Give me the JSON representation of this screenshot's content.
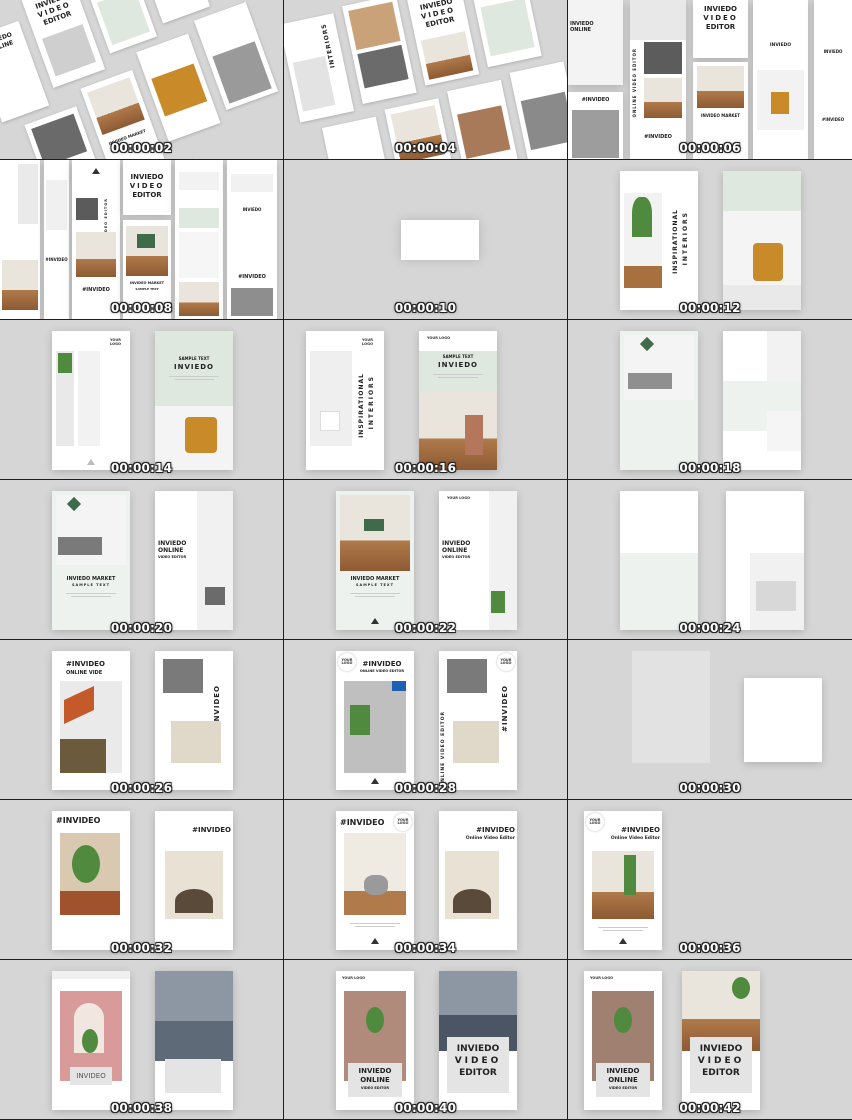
{
  "timestamps": [
    "00:00:02",
    "00:00:04",
    "00:00:06",
    "00:00:08",
    "00:00:10",
    "00:00:12",
    "00:00:14",
    "00:00:16",
    "00:00:18",
    "00:00:20",
    "00:00:22",
    "00:00:24",
    "00:00:26",
    "00:00:28",
    "00:00:30",
    "00:00:32",
    "00:00:34",
    "00:00:36",
    "00:00:38",
    "00:00:40",
    "00:00:42"
  ],
  "text": {
    "inviedo": "INVIEDO",
    "video": "VIDEO",
    "editor": "EDITOR",
    "online": "ONLINE",
    "inviedo_online": "INVIEDO ONLINE",
    "inviedo_video_editor": "INVIEDO VIDEO EDITOR",
    "inviedo_market": "INVIEDO MARKET",
    "invideo_market": "INVIDEO MARKET",
    "sample_text": "SAMPLE TEXT",
    "sample_text_small": "SAMPLE TEXT",
    "invideo": "INVIDEO",
    "invideo_upper": "INVIDEO",
    "invideo_caps": "INVIDEO",
    "video_editor": "VIDEO EDITOR",
    "online_video_editor": "ONLINE VIDEO EDITOR",
    "online_video_editor_title": "Online Video Editor",
    "hash_invideo": "#INVIDEO",
    "hash_invideo_online": "#INVIDEO ONLINE",
    "online_vide": "ONLINE VIDE",
    "inspirational": "INSPIRATIONAL",
    "interiors": "INTERIORS",
    "your_logo": "YOUR LOGO",
    "your": "YOUR",
    "logo": "LOGO",
    "market_sample": "INVIEDO MARKET SAMPLE TEXT",
    "online_video_editor_upper": "ONLINE VIDEO EDITOR",
    "your_logo_line1": "YOUR",
    "your_logo_line2": "LOGO"
  },
  "colors": {
    "cell_bg": "#d6d6d6",
    "grid_line": "#1e1e1e",
    "accent_green": "#dfe8df",
    "accent_grey": "#e4e4e4",
    "chair_yellow": "#c98b2a",
    "wood": "#a8703f",
    "blue_mark": "#1f5fb4",
    "pink": "#d99a9a"
  }
}
